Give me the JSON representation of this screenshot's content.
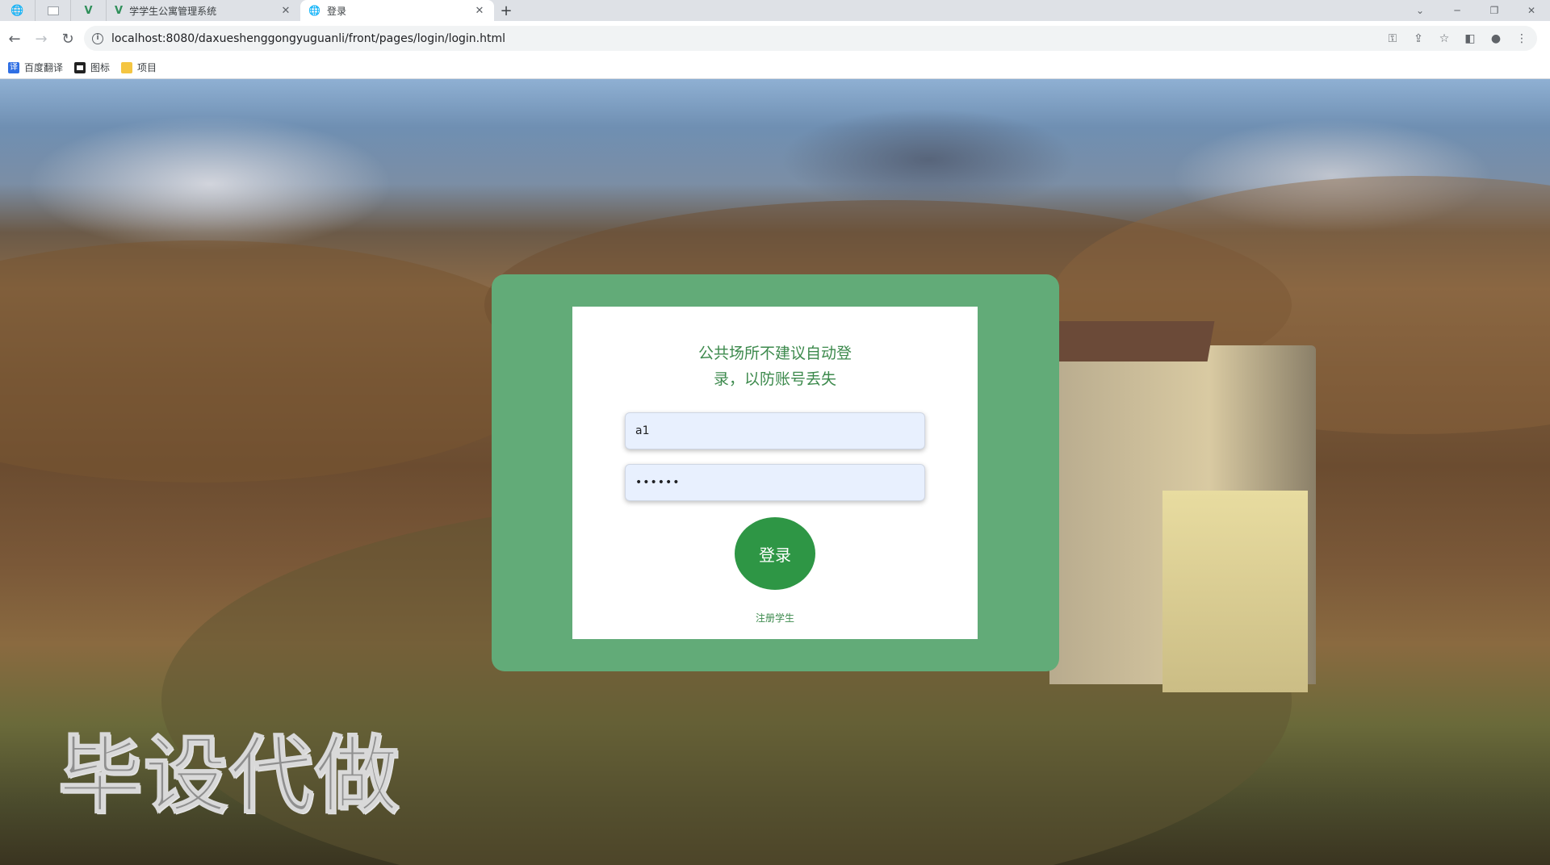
{
  "browser": {
    "tabs": [
      {
        "title": "学学生公寓管理系统",
        "active": false
      },
      {
        "title": "登录",
        "active": true
      }
    ],
    "url": "localhost:8080/daxueshenggongyuguanli/front/pages/login/login.html",
    "bookmarks": [
      {
        "label": "百度翻译"
      },
      {
        "label": "图标"
      },
      {
        "label": "项目"
      }
    ]
  },
  "login": {
    "notice_line1": "公共场所不建议自动登",
    "notice_line2": "录，以防账号丢失",
    "username_value": "a1",
    "password_value": "••••••",
    "login_button": "登录",
    "register_link": "注册学生"
  },
  "watermark": "毕设代做",
  "colors": {
    "card_outer": "#62ab78",
    "card_inner": "#ffffff",
    "accent_text": "#3d8a4d",
    "login_button": "#2e9645",
    "input_bg": "#e8f0fe"
  },
  "icons": {
    "back": "arrow-left",
    "forward": "arrow-right",
    "reload": "reload",
    "site_info": "info",
    "key": "key",
    "share": "share",
    "bookmark": "star",
    "sidepanel": "sidepanel",
    "profile": "person",
    "menu": "kebab"
  }
}
